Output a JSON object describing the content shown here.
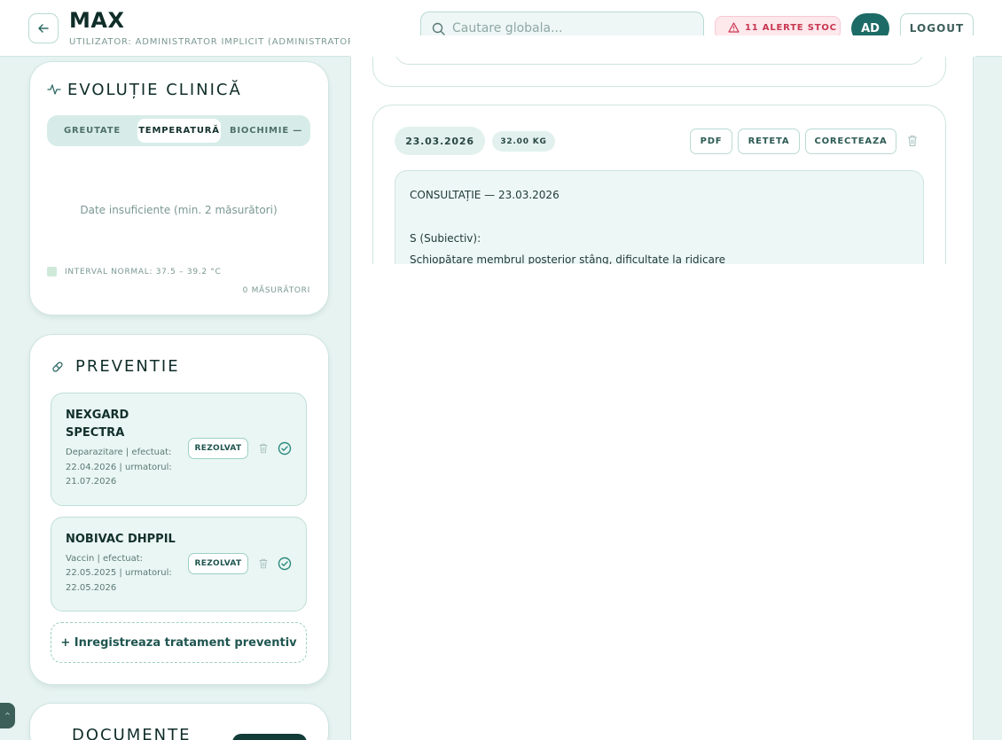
{
  "header": {
    "title": "MAX",
    "subtitle": "UTILIZATOR: ADMINISTRATOR IMPLICIT (ADMINISTRATOR)",
    "search_placeholder": "Cautare globala...",
    "alert_label": "11 ALERTE STOC",
    "avatar_initials": "AD",
    "logout_label": "LOGOUT"
  },
  "evolution": {
    "title": "EVOLUȚIE CLINICĂ",
    "tabs": [
      "GREUTATE",
      "TEMPERATURĂ",
      "BIOCHIMIE —"
    ],
    "active_tab": "TEMPERATURĂ",
    "empty_message": "Date insuficiente (min. 2 măsurători)",
    "legend": "INTERVAL NORMAL: 37.5 – 39.2 °C",
    "count": "0 MĂSURĂTORI"
  },
  "prevention": {
    "title": "PREVENTIE",
    "items": [
      {
        "name_line1": "NEXGARD",
        "name_line2": "SPECTRA",
        "meta_line1": "Deparazitare | efectuat:",
        "meta_line2": "22.04.2026 | urmatorul:",
        "meta_line3": "21.07.2026",
        "status": "REZOLVAT"
      },
      {
        "name_line1": "NOBIVAC DHPPIL",
        "meta_line1": "Vaccin | efectuat:",
        "meta_line2": "22.05.2025 | urmatorul:",
        "meta_line3": "22.05.2026",
        "status": "REZOLVAT"
      }
    ],
    "add_label": "+ Inregistreaza tratament preventiv"
  },
  "documents": {
    "title": "DOCUMENTE"
  },
  "consultation": {
    "date": "23.03.2026",
    "weight": "32.00 KG",
    "actions": [
      "PDF",
      "RETETA",
      "CORECTEAZA"
    ],
    "heading": "CONSULTAȚIE — 23.03.2026",
    "section_label": "S (Subiectiv):",
    "section_text": "Schiopătare membrul posterior stâng, dificultate la ridicare"
  },
  "colors": {
    "accent": "#1d6b66",
    "background": "#e6f3f1",
    "alert": "#c8364f"
  }
}
